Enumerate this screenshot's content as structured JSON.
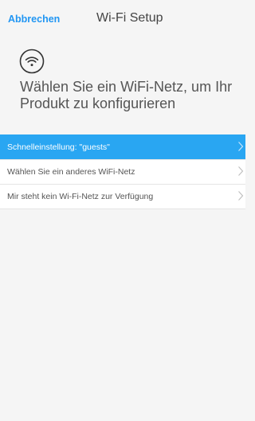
{
  "header": {
    "cancel_label": "Abbrechen",
    "title": "Wi-Fi Setup"
  },
  "main": {
    "icon": "wifi-icon",
    "heading": "Wählen Sie ein WiFi-Netz, um Ihr Produkt zu konfigurieren"
  },
  "options": [
    {
      "label": "Schnelleinstellung: \"guests\"",
      "selected": true
    },
    {
      "label": "Wählen Sie ein anderes WiFi-Netz",
      "selected": false
    },
    {
      "label": "Mir steht kein Wi-Fi-Netz zur Verfügung",
      "selected": false
    }
  ],
  "colors": {
    "accent": "#2196f3",
    "selected_row": "#29a6f2",
    "background": "#f5f5f5"
  }
}
